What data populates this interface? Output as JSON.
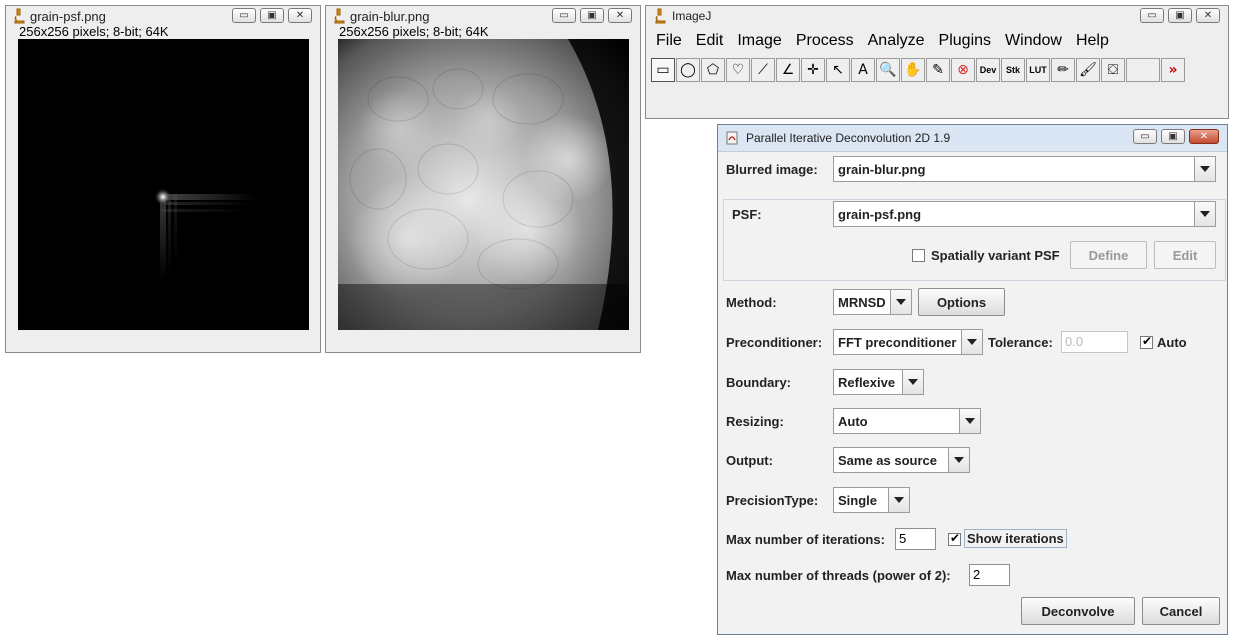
{
  "psf_window": {
    "title": "grain-psf.png",
    "info": "256x256 pixels; 8-bit; 64K"
  },
  "blur_window": {
    "title": "grain-blur.png",
    "info": "256x256 pixels; 8-bit; 64K"
  },
  "imagej": {
    "title": "ImageJ",
    "menu": [
      "File",
      "Edit",
      "Image",
      "Process",
      "Analyze",
      "Plugins",
      "Window",
      "Help"
    ],
    "tools": [
      {
        "name": "rectangle-tool-icon",
        "glyph": "▭"
      },
      {
        "name": "oval-tool-icon",
        "glyph": "◯"
      },
      {
        "name": "polygon-tool-icon",
        "glyph": "⬠"
      },
      {
        "name": "freehand-tool-icon",
        "glyph": "♡"
      },
      {
        "name": "line-tool-icon",
        "glyph": "⟋"
      },
      {
        "name": "angle-tool-icon",
        "glyph": "∠"
      },
      {
        "name": "point-tool-icon",
        "glyph": "✛"
      },
      {
        "name": "wand-tool-icon",
        "glyph": "↖"
      },
      {
        "name": "text-tool-icon",
        "glyph": "A"
      },
      {
        "name": "magnifier-tool-icon",
        "glyph": "🔍"
      },
      {
        "name": "hand-tool-icon",
        "glyph": "✋"
      },
      {
        "name": "dropper-tool-icon",
        "glyph": "✎"
      },
      {
        "name": "clear-tool-icon",
        "glyph": "⊗"
      },
      {
        "name": "dev-menu-icon",
        "glyph": "Dev"
      },
      {
        "name": "stk-menu-icon",
        "glyph": "Stk"
      },
      {
        "name": "lut-menu-icon",
        "glyph": "LUT"
      },
      {
        "name": "pencil-tool-icon",
        "glyph": "✏"
      },
      {
        "name": "brush-tool-icon",
        "glyph": "🖌"
      },
      {
        "name": "flood-fill-tool-icon",
        "glyph": "⛋"
      },
      {
        "name": "empty-slot-icon",
        "glyph": ""
      },
      {
        "name": "more-tools-icon",
        "glyph": "»"
      }
    ]
  },
  "dialog": {
    "title": "Parallel Iterative Deconvolution 2D 1.9",
    "blurred_label": "Blurred image:",
    "blurred_value": "grain-blur.png",
    "psf_label": "PSF:",
    "psf_value": "grain-psf.png",
    "spatially_variant_label": "Spatially variant PSF",
    "define_label": "Define",
    "edit_label": "Edit",
    "method_label": "Method:",
    "method_value": "MRNSD",
    "options_label": "Options",
    "preconditioner_label": "Preconditioner:",
    "preconditioner_value": "FFT preconditioner",
    "tolerance_label": "Tolerance:",
    "tolerance_value": "0.0",
    "auto_label": "Auto",
    "boundary_label": "Boundary:",
    "boundary_value": "Reflexive",
    "resizing_label": "Resizing:",
    "resizing_value": "Auto",
    "output_label": "Output:",
    "output_value": "Same as source",
    "precision_label": "PrecisionType:",
    "precision_value": "Single",
    "iterations_label": "Max number of iterations:",
    "iterations_value": "5",
    "show_iterations_label": "Show iterations",
    "threads_label": "Max number of threads (power of 2):",
    "threads_value": "2",
    "deconvolve_label": "Deconvolve",
    "cancel_label": "Cancel"
  }
}
